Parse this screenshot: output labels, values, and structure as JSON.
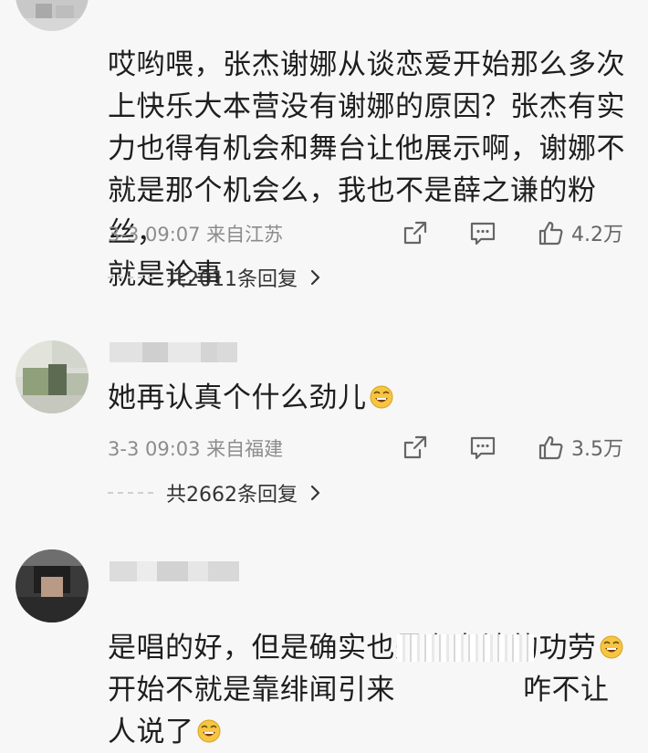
{
  "comments": [
    {
      "text_line1": "哎哟喂，张杰谢娜从谈恋爱开始那么多次",
      "text_line2": "上快乐大本营没有谢娜的原因？张杰有实",
      "text_line3": "力也得有机会和舞台让他展示啊，谢娜不",
      "text_line4": "就是那个机会么，我也不是薛之谦的粉丝，",
      "text_line5": "就是论事",
      "time": "3-3 09:07  来自江苏",
      "likes": "4.2万",
      "replies": "共2011条回复"
    },
    {
      "text": "她再认真个什么劲儿",
      "time": "3-3 09:03  来自福建",
      "likes": "3.5万",
      "replies": "共2662条回复"
    },
    {
      "text_line1": "是唱的好，但是确实也是有老婆的功劳",
      "text_line2a": "开始不就是靠绯闻引来",
      "text_line2b": "咋不让",
      "text_line3": "人说了"
    }
  ],
  "icons": {
    "share": "share-icon",
    "comment": "comment-icon",
    "like": "thumbs-up-icon",
    "reply_more": "chevron-right-icon",
    "emoji": "laughing-emoji-icon"
  },
  "colors": {
    "background": "#f7f7f7",
    "meta_text": "#8c8c8c",
    "body_text": "#1e1e1e"
  }
}
